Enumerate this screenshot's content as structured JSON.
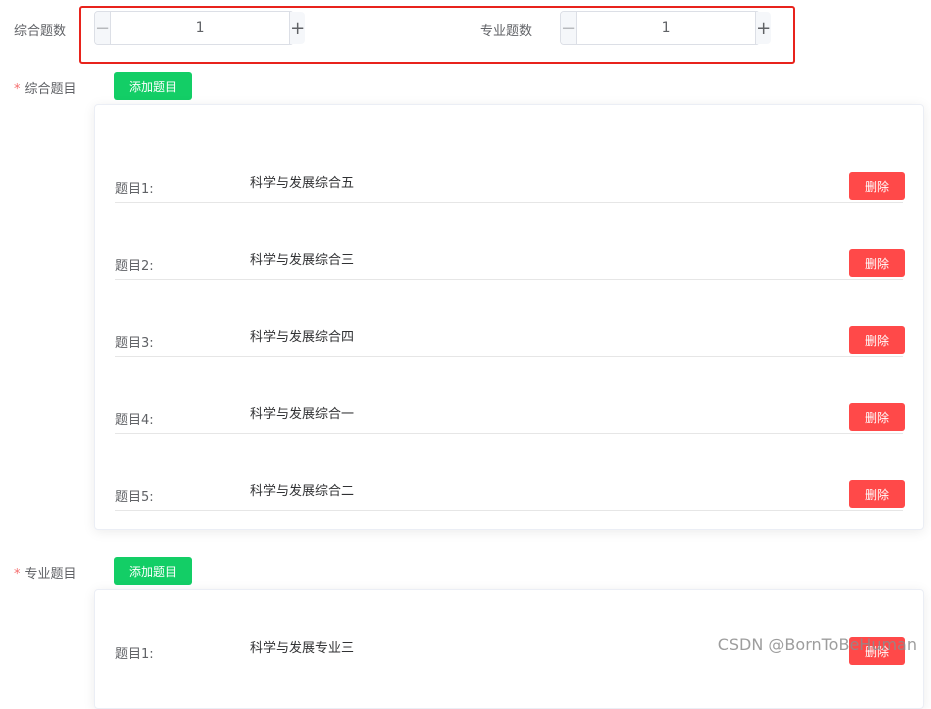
{
  "counts": {
    "general_label": "综合题数",
    "general_value": "1",
    "professional_label": "专业题数",
    "professional_value": "1",
    "minus_symbol": "−",
    "plus_symbol": "+"
  },
  "general_section": {
    "required_mark": "*",
    "label": "综合题目",
    "add_button": "添加题目",
    "questions": [
      {
        "label": "题目1:",
        "title": "科学与发展综合五",
        "delete": "删除"
      },
      {
        "label": "题目2:",
        "title": "科学与发展综合三",
        "delete": "删除"
      },
      {
        "label": "题目3:",
        "title": "科学与发展综合四",
        "delete": "删除"
      },
      {
        "label": "题目4:",
        "title": "科学与发展综合一",
        "delete": "删除"
      },
      {
        "label": "题目5:",
        "title": "科学与发展综合二",
        "delete": "删除"
      }
    ]
  },
  "professional_section": {
    "required_mark": "*",
    "label": "专业题目",
    "add_button": "添加题目",
    "questions": [
      {
        "label": "题目1:",
        "title": "科学与发展专业三",
        "delete": "删除"
      }
    ]
  },
  "watermark": "CSDN @BornToBeHuman",
  "colors": {
    "highlight": "#e8231c",
    "add_button": "#13ce66",
    "delete_button": "#ff4949",
    "required": "#f56c6c"
  }
}
